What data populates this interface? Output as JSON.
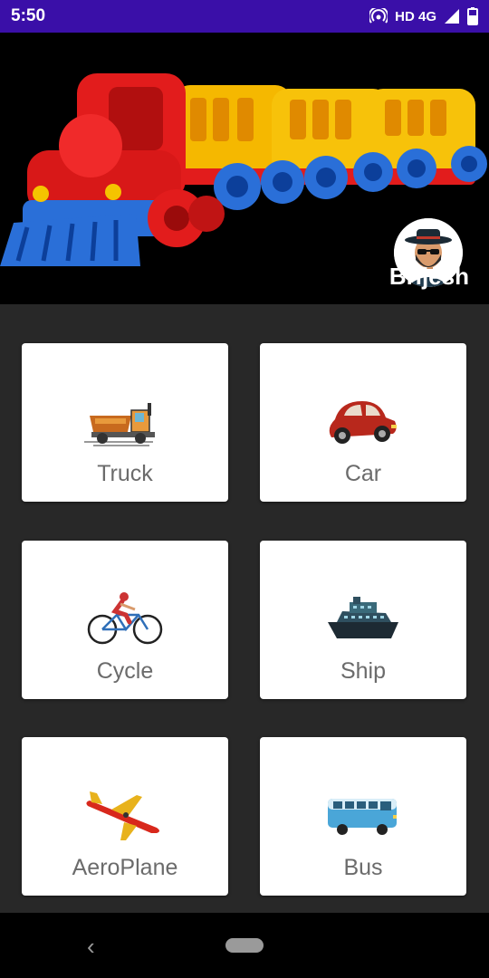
{
  "status_bar": {
    "time": "5:50",
    "network": "HD 4G",
    "icons": [
      "hotspot-icon",
      "signal-icon",
      "battery-icon"
    ]
  },
  "header": {
    "profile_name": "Brijesh",
    "image": "toy-train",
    "avatar": "man-with-hat-avatar"
  },
  "grid": {
    "items": [
      {
        "label": "Truck",
        "icon": "truck-icon"
      },
      {
        "label": "Car",
        "icon": "car-icon"
      },
      {
        "label": "Cycle",
        "icon": "cycle-icon"
      },
      {
        "label": "Ship",
        "icon": "ship-icon"
      },
      {
        "label": "AeroPlane",
        "icon": "aeroplane-icon"
      },
      {
        "label": "Bus",
        "icon": "bus-icon"
      }
    ]
  },
  "nav": {
    "back_symbol": "‹",
    "icons": [
      "back-icon",
      "home-pill-icon"
    ]
  },
  "colors": {
    "status_bar": "#3a0fa8",
    "background": "#282828",
    "header_bg": "#000000",
    "card_bg": "#ffffff",
    "label_text": "#6b6b6b"
  }
}
